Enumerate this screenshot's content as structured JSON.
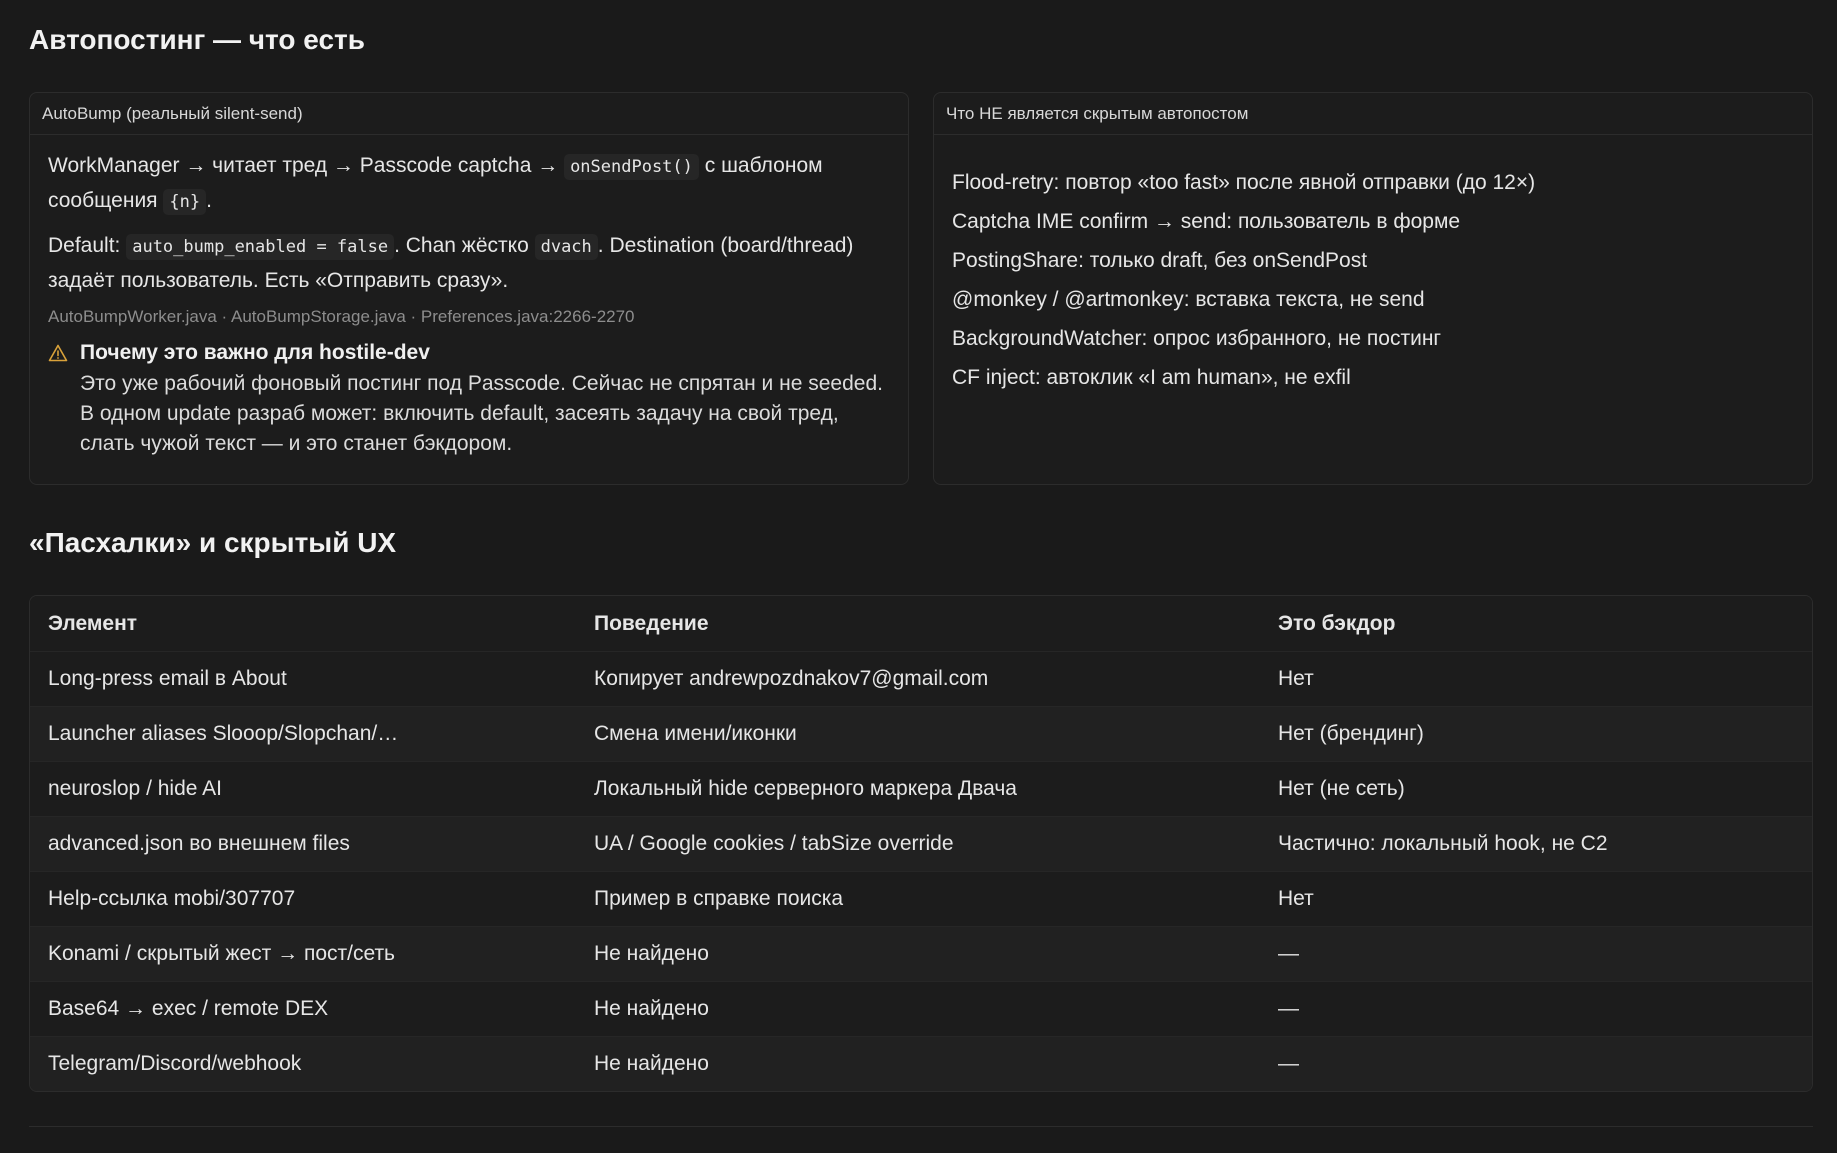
{
  "autoposting": {
    "heading": "Автопостинг — что есть",
    "left_card": {
      "title": "AutoBump (реальный silent-send)",
      "p1_a": "WorkManager → читает тред → Passcode captcha →",
      "p1_code1": "onSendPost()",
      "p1_b": "с шаблоном сообщения",
      "p1_code2": "{n}",
      "p1_c": ".",
      "p2_a": "Default:",
      "p2_code1": "auto_bump_enabled = false",
      "p2_b": ". Chan жёстко",
      "p2_code2": "dvach",
      "p2_c": ". Destination (board/thread) задаёт пользователь. Есть «Отправить сразу».",
      "files": "AutoBumpWorker.java · AutoBumpStorage.java · Preferences.java:2266-2270",
      "warning_title": "Почему это важно для hostile-dev",
      "warning_text": "Это уже рабочий фоновый постинг под Passcode. Сейчас не спрятан и не seeded. В одном update разраб может: включить default, засеять задачу на свой тред, слать чужой текст — и это станет бэкдором.",
      "warning_icon": "warning-triangle-icon",
      "warning_color": "#d9a23a"
    },
    "right_card": {
      "title": "Что НЕ является скрытым автопостом",
      "items": [
        "Flood-retry: повтор «too fast» после явной отправки (до 12×)",
        "Captcha IME confirm → send: пользователь в форме",
        "PostingShare: только draft, без onSendPost",
        "@monkey / @artmonkey: вставка текста, не send",
        "BackgroundWatcher: опрос избранного, не постинг",
        "CF inject: автоклик «I am human», не exfil"
      ]
    }
  },
  "easter": {
    "heading": "«Пасхалки» и скрытый UX",
    "columns": [
      "Элемент",
      "Поведение",
      "Это бэкдор"
    ],
    "rows": [
      [
        "Long-press email в About",
        "Копирует andrewpozdnakov7@gmail.com",
        "Нет"
      ],
      [
        "Launcher aliases Slooop/Slopchan/…",
        "Смена имени/иконки",
        "Нет (брендинг)"
      ],
      [
        "neuroslop / hide AI",
        "Локальный hide серверного маркера Двача",
        "Нет (не сеть)"
      ],
      [
        "advanced.json во внешнем files",
        "UA / Google cookies / tabSize override",
        "Частично: локальный hook, не C2"
      ],
      [
        "Help-ссылка mobi/307707",
        "Пример в справке поиска",
        "Нет"
      ],
      [
        "Konami / скрытый жест → пост/сеть",
        "Не найдено",
        "—"
      ],
      [
        "Base64 → exec / remote DEX",
        "Не найдено",
        "—"
      ],
      [
        "Telegram/Discord/webhook",
        "Не найдено",
        "—"
      ]
    ]
  }
}
